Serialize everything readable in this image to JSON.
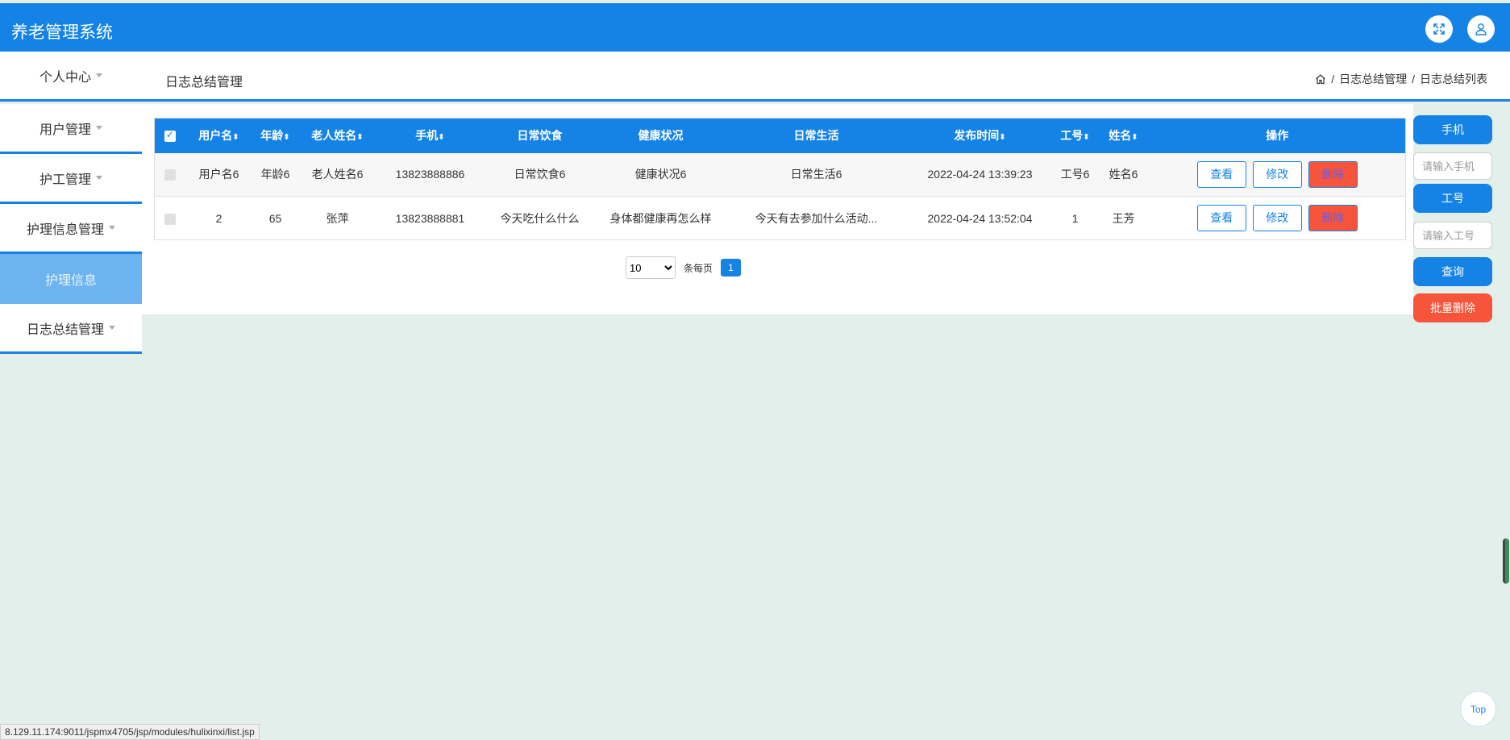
{
  "header": {
    "title": "养老管理系统",
    "fullscreen_icon": "fullscreen-icon",
    "user_icon": "user-icon"
  },
  "sidebar": {
    "items": [
      {
        "label": "个人中心"
      },
      {
        "label": "用户管理"
      },
      {
        "label": "护工管理"
      },
      {
        "label": "护理信息管理"
      },
      {
        "label": "日志总结管理"
      }
    ],
    "active_sub": "护理信息"
  },
  "page": {
    "title": "日志总结管理",
    "breadcrumb": [
      "日志总结管理",
      "日志总结列表"
    ],
    "breadcrumb_sep": "/"
  },
  "table": {
    "columns": [
      "用户名",
      "年龄",
      "老人姓名",
      "手机",
      "日常饮食",
      "健康状况",
      "日常生活",
      "发布时间",
      "工号",
      "姓名",
      "操作"
    ],
    "sort_glyph": "⬍",
    "rows": [
      {
        "c": [
          "用户名6",
          "年龄6",
          "老人姓名6",
          "13823888886",
          "日常饮食6",
          "健康状况6",
          "日常生活6",
          "2022-04-24 13:39:23",
          "工号6",
          "姓名6"
        ]
      },
      {
        "c": [
          "2",
          "65",
          "张萍",
          "13823888881",
          "今天吃什么什么",
          "身体都健康再怎么样",
          "今天有去参加什么活动...",
          "2022-04-24 13:52:04",
          "1",
          "王芳"
        ]
      }
    ],
    "actions": {
      "view": "查看",
      "edit": "修改",
      "delete": "删除"
    }
  },
  "pager": {
    "page_size": "10",
    "per_page_label": "条每页",
    "current": "1"
  },
  "search": {
    "phone_label": "手机",
    "phone_placeholder": "请输入手机",
    "id_label": "工号",
    "id_placeholder": "请输入工号",
    "query": "查询",
    "batch_delete": "批量删除"
  },
  "status_url": "8.129.11.174:9011/jspmx4705/jsp/modules/hulixinxi/list.jsp",
  "top_button": "Top",
  "colors": {
    "primary": "#1583e6",
    "danger": "#f6553b",
    "background": "#e3efea",
    "active_sub": "#6db3ef"
  }
}
